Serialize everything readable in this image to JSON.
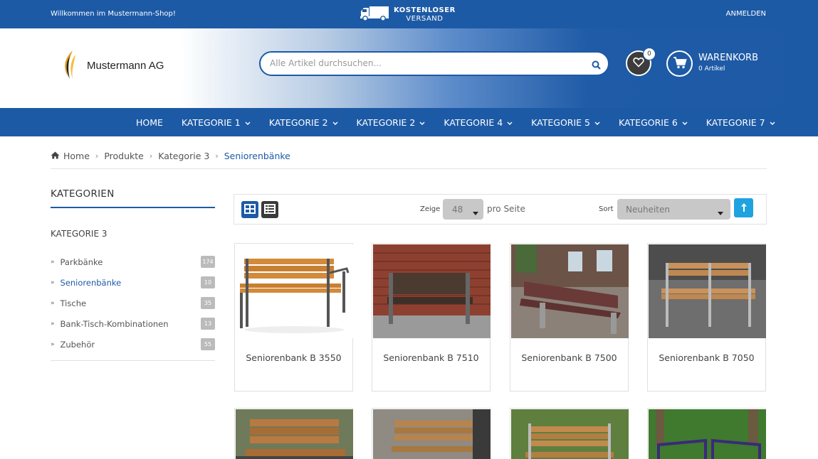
{
  "topbar": {
    "welcome": "Willkommen im Mustermann-Shop!",
    "shipping_line1": "KOSTENLOSER",
    "shipping_line2": "VERSAND",
    "login": "ANMELDEN"
  },
  "header": {
    "logo_text": "Mustermann AG",
    "search_placeholder": "Alle Artikel durchsuchen...",
    "wishlist_count": "0",
    "cart_title": "WARENKORB",
    "cart_sub": "0 Artikel"
  },
  "nav": {
    "items": [
      "HOME",
      "KATEGORIE 1",
      "KATEGORIE 2",
      "KATEGORIE 2",
      "KATEGORIE 4",
      "KATEGORIE 5",
      "KATEGORIE 6",
      "KATEGORIE 7"
    ]
  },
  "breadcrumb": {
    "home": "Home",
    "items": [
      "Produkte",
      "Kategorie 3",
      "Seniorenbänke"
    ]
  },
  "sidebar": {
    "title": "KATEGORIEN",
    "subtitle": "KATEGORIE 3",
    "items": [
      {
        "label": "Parkbänke",
        "count": "174"
      },
      {
        "label": "Seniorenbänke",
        "count": "10"
      },
      {
        "label": "Tische",
        "count": "35"
      },
      {
        "label": "Bank-Tisch-Kombinationen",
        "count": "13"
      },
      {
        "label": "Zubehör",
        "count": "55"
      }
    ]
  },
  "toolbar": {
    "show_label": "Zeige",
    "per_page_value": "48",
    "per_page_suffix": "pro Seite",
    "sort_label": "Sort",
    "sort_value": "Neuheiten"
  },
  "products": [
    {
      "title": "Seniorenbank B 3550"
    },
    {
      "title": "Seniorenbank B 7510"
    },
    {
      "title": "Seniorenbank B 7500"
    },
    {
      "title": "Seniorenbank B 7050"
    }
  ],
  "colors": {
    "primary": "#1d5aa6",
    "accent": "#1fa3e0"
  }
}
